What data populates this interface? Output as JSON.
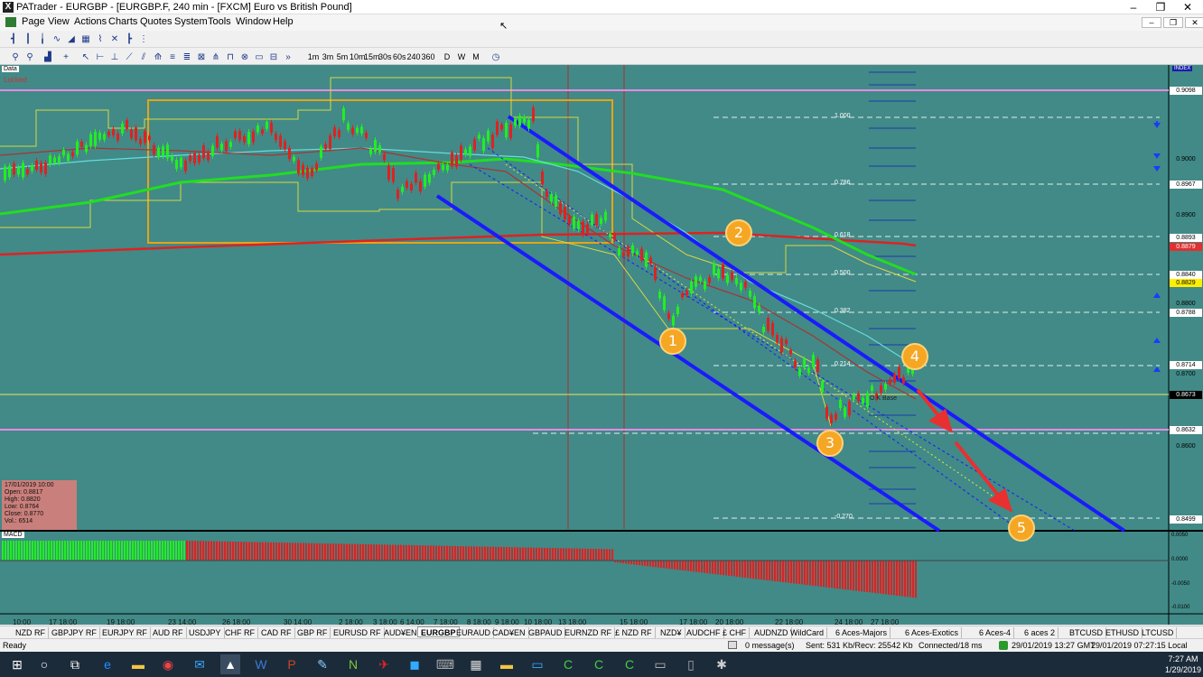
{
  "window": {
    "title": "PATrader - EURGBP - [EURGBP.F, 240 min - [FXCM] Euro vs British Pound]",
    "app_icon": "X",
    "controls": [
      "–",
      "❐",
      "✕"
    ]
  },
  "menu": [
    "Page",
    "View",
    "Actions",
    "Charts",
    "Quotes",
    "System",
    "Tools",
    "Window",
    "Help"
  ],
  "mdi_controls": [
    "–",
    "❐",
    "✕"
  ],
  "timeframes": [
    "1m",
    "3m",
    "5m",
    "10m",
    "15m",
    "30s",
    "60s",
    "240",
    "360",
    "D",
    "W",
    "M"
  ],
  "chart": {
    "data_label": "Data",
    "locked_label": "Locked",
    "index_label": "INDEX",
    "macd_label": "MACD",
    "base_label": "O.K Base",
    "infobox": {
      "date": "17/01/2019 10:00",
      "open": "Open: 0.8817",
      "high": "High: 0.8820",
      "low": "Low: 0.8764",
      "close": "Close: 0.8770",
      "vol": "Vol.: 6514"
    },
    "price_labels": [
      {
        "text": "0.9098",
        "bg": "#ffffff"
      },
      {
        "text": "0.9000",
        "bg": ""
      },
      {
        "text": "0.8967",
        "bg": "#ffffff"
      },
      {
        "text": "0.8900",
        "bg": ""
      },
      {
        "text": "0.8893",
        "bg": "#ffffff"
      },
      {
        "text": "0.8879",
        "bg": "#e03030"
      },
      {
        "text": "0.8840",
        "bg": "#ffffff"
      },
      {
        "text": "0.8829",
        "bg": "#ffee00"
      },
      {
        "text": "0.8800",
        "bg": ""
      },
      {
        "text": "0.8788",
        "bg": "#ffffff"
      },
      {
        "text": "0.8714",
        "bg": "#ffffff"
      },
      {
        "text": "0.8700",
        "bg": ""
      },
      {
        "text": "0.8673",
        "bg": "#000000"
      },
      {
        "text": "0.8632",
        "bg": "#ffffff"
      },
      {
        "text": "0.8600",
        "bg": ""
      },
      {
        "text": "0.8499",
        "bg": "#ffffff"
      }
    ],
    "macd_labels": [
      "0.0050",
      "0.0000",
      "-0.0050",
      "-0.0100"
    ],
    "fib_levels": [
      "1.000",
      "0.786",
      "0.618",
      "0.500",
      "0.382",
      "0.214",
      "-0.270"
    ],
    "wave_labels": [
      "1",
      "2",
      "3",
      "4",
      "5"
    ],
    "time_labels": [
      "10:00",
      "17 18:00",
      "19 18:00",
      "23 14:00",
      "26 18:00",
      "30 14:00",
      "2 18:00",
      "3 18:00",
      "6 14:00",
      "7 18:00",
      "8 18:00",
      "9 18:00",
      "10 18:00",
      "13 18:00",
      "15 18:00",
      "17 18:00",
      "20 18:00",
      "22 18:00",
      "24 18:00",
      "27 18:00"
    ],
    "colors": {
      "background": "#418a87",
      "channel": "#1a1aff",
      "ema_green": "#22dd22",
      "ema_red": "#dd2222",
      "box": "#e8a317",
      "wave": "#f5a623",
      "arrow": "#e83030"
    }
  },
  "tabs": [
    "NZD RF",
    "GBPJPY RF",
    "EURJPY RF",
    "AUD RF",
    "USDJPY",
    "CHF RF",
    "CAD RF",
    "GBP RF",
    "EURUSD RF",
    "AUD¥EN",
    "EURGBP",
    "EURAUD",
    "CAD¥EN",
    "GBPAUD",
    "EURNZD RF",
    "£ NZD RF",
    "NZD¥",
    "AUDCHF",
    "£ CHF",
    "AUDNZD",
    "WildCard",
    "6 Aces-Majors",
    "6 Aces-Exotics",
    "6 Aces-4",
    "6 aces 2",
    "BTCUSD",
    "ETHUSD",
    "LTCUSD"
  ],
  "active_tab": "EURGBP",
  "status": {
    "ready": "Ready",
    "messages": "0 message(s)",
    "traffic": "Sent: 531 Kb/Recv: 25542 Kb",
    "connection": "Connected/18 ms",
    "gmt": "29/01/2019 13:27 GMT",
    "local": "29/01/2019 07:27:15 Local"
  },
  "taskbar": {
    "time": "7:27 AM",
    "date": "1/29/2019"
  }
}
